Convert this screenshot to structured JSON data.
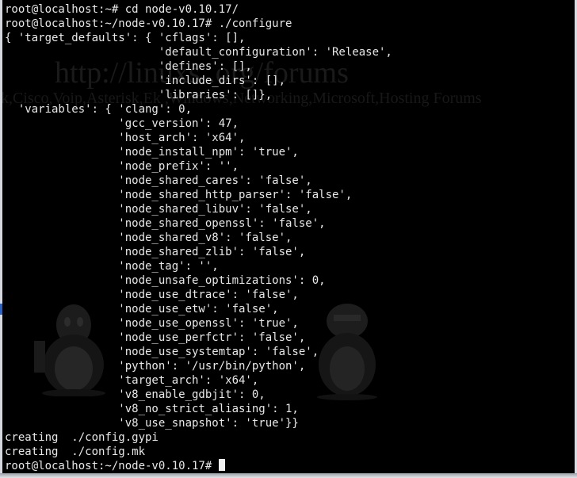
{
  "terminal": {
    "lines": [
      "root@localhost:~# cd node-v0.10.17/",
      "root@localhost:~/node-v0.10.17# ./configure",
      "{ 'target_defaults': { 'cflags': [],",
      "                       'default_configuration': 'Release',",
      "                       'defines': [],",
      "                       'include_dirs': [],",
      "                       'libraries': []},",
      "  'variables': { 'clang': 0,",
      "                 'gcc_version': 47,",
      "                 'host_arch': 'x64',",
      "                 'node_install_npm': 'true',",
      "                 'node_prefix': '',",
      "                 'node_shared_cares': 'false',",
      "                 'node_shared_http_parser': 'false',",
      "                 'node_shared_libuv': 'false',",
      "                 'node_shared_openssl': 'false',",
      "                 'node_shared_v8': 'false',",
      "                 'node_shared_zlib': 'false',",
      "                 'node_tag': '',",
      "                 'node_unsafe_optimizations': 0,",
      "                 'node_use_dtrace': 'false',",
      "                 'node_use_etw': 'false',",
      "                 'node_use_openssl': 'true',",
      "                 'node_use_perfctr': 'false',",
      "                 'node_use_systemtap': 'false',",
      "                 'python': '/usr/bin/python',",
      "                 'target_arch': 'x64',",
      "                 'v8_enable_gdbjit': 0,",
      "                 'v8_no_strict_aliasing': 1,",
      "                 'v8_use_snapshot': 'true'}}",
      "creating  ./config.gypi",
      "creating  ./config.mk"
    ],
    "prompt": "root@localhost:~/node-v0.10.17# "
  },
  "watermark": {
    "url": "http://linuxs        .org/forums",
    "tagline": "k,Cisco,Voip,Asterisk,Ek          ,Windows,Networking,Microsoft,Hosting Forums"
  },
  "colors": {
    "background": "#000000",
    "text": "#e8e8e8",
    "cursor": "#f0f0f0",
    "left_marker": "#2a63c7"
  },
  "icons": [
    "tux-penguin-icon",
    "tux-penguin-icon"
  ]
}
